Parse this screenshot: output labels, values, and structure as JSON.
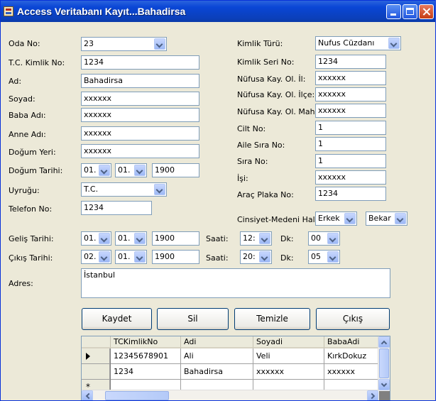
{
  "window": {
    "title": "Access Veritabanı Kayıt...Bahadirsa"
  },
  "form": {
    "oda_no": {
      "label": "Oda No:",
      "value": "23"
    },
    "tc_kimlik_no": {
      "label": "T.C. Kimlik No:",
      "value": "1234"
    },
    "ad": {
      "label": "Ad:",
      "value": "Bahadirsa"
    },
    "soyad": {
      "label": "Soyad:",
      "value": "xxxxxx"
    },
    "baba_adi": {
      "label": "Baba Adı:",
      "value": "xxxxxx"
    },
    "anne_adi": {
      "label": "Anne Adı:",
      "value": "xxxxxx"
    },
    "dogum_yeri": {
      "label": "Doğum Yeri:",
      "value": "xxxxxx"
    },
    "dogum_tarihi": {
      "label": "Doğum Tarihi:",
      "day": "01.",
      "month": "01.",
      "year": "1900"
    },
    "uyrugu": {
      "label": "Uyruğu:",
      "value": "T.C."
    },
    "telefon_no": {
      "label": "Telefon No:",
      "value": "1234"
    },
    "kimlik_turu": {
      "label": "Kimlik Türü:",
      "value": "Nufus Cüzdanı"
    },
    "kimlik_seri_no": {
      "label": "Kimlik Seri No:",
      "value": "1234"
    },
    "nufusa_kay_il": {
      "label": "Nüfusa Kay. Ol. İl:",
      "value": "xxxxxx"
    },
    "nufusa_kay_ilce": {
      "label": "Nüfusa Kay. Ol. İlçe:",
      "value": "xxxxxx"
    },
    "nufusa_kay_mah": {
      "label": "Nüfusa Kay. Ol. Mah.",
      "value": "xxxxxx"
    },
    "cilt_no": {
      "label": "Cilt No:",
      "value": "1"
    },
    "aile_sira_no": {
      "label": "Aile Sıra No:",
      "value": "1"
    },
    "sira_no": {
      "label": "Sıra No:",
      "value": "1"
    },
    "isi": {
      "label": "İşi:",
      "value": "xxxxxx"
    },
    "arac_plaka_no": {
      "label": "Araç Plaka No:",
      "value": "1234"
    },
    "cinsiyet_medeni_hal": {
      "label": "Cinsiyet-Medeni Hal",
      "cinsiyet": "Erkek",
      "medeni_hal": "Bekar"
    },
    "gelis_tarihi": {
      "label": "Geliş Tarihi:",
      "day": "01.",
      "month": "01.",
      "year": "1900",
      "saat_label": "Saati:",
      "saat": "12:",
      "dk_label": "Dk:",
      "dk": "00"
    },
    "cikis_tarihi": {
      "label": "Çıkış Tarihi:",
      "day": "02.",
      "month": "01.",
      "year": "1900",
      "saat_label": "Saati:",
      "saat": "20:",
      "dk_label": "Dk:",
      "dk": "05"
    },
    "adres": {
      "label": "Adres:",
      "value": "İstanbul"
    }
  },
  "buttons": {
    "kaydet": "Kaydet",
    "sil": "Sil",
    "temizle": "Temizle",
    "cikis": "Çıkış"
  },
  "grid": {
    "columns": [
      "TCKimlikNo",
      "Adi",
      "Soyadi",
      "BabaAdi"
    ],
    "rows": [
      [
        "12345678901",
        "Ali",
        "Veli",
        "KırkDokuz"
      ],
      [
        "1234",
        "Bahadirsa",
        "xxxxxx",
        "xxxxxx"
      ]
    ]
  }
}
